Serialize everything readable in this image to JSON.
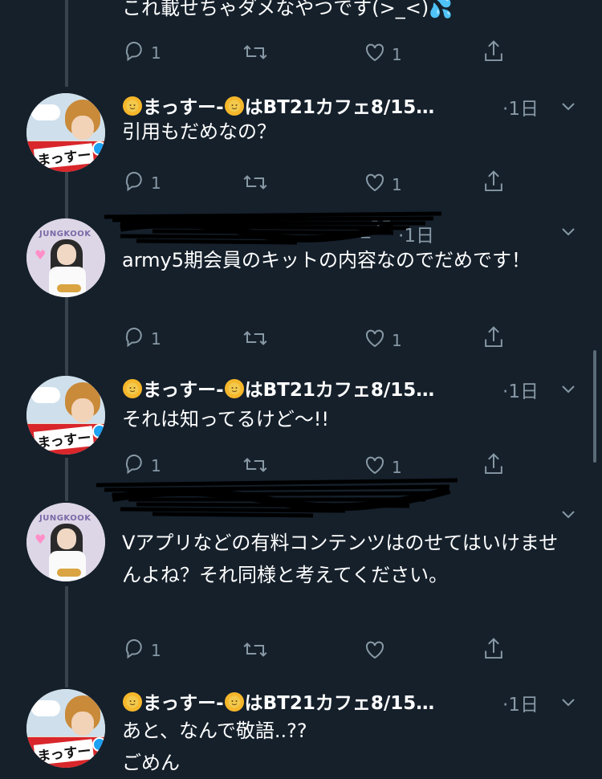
{
  "tweets": [
    {
      "body": "これ載せちゃダメなやつです(>_<)💦",
      "actions": {
        "reply_count": "1",
        "retweet_count": "",
        "like_count": "1"
      }
    },
    {
      "display_name": "まっすー",
      "name_suffix": "はBT21カフェ8/15…",
      "time": "1日",
      "body": "引用もだめなの？",
      "actions": {
        "reply_count": "1",
        "retweet_count": "",
        "like_count": "1"
      }
    },
    {
      "display_name_partial": "_25",
      "time": "1日",
      "body": "army5期会員のキットの内容なのでだめです！",
      "actions": {
        "reply_count": "1",
        "retweet_count": "",
        "like_count": "1"
      }
    },
    {
      "display_name": "まっすー",
      "name_suffix": "はBT21カフェ8/15…",
      "time": "1日",
      "body": "それは知ってるけど〜!!",
      "actions": {
        "reply_count": "1",
        "retweet_count": "",
        "like_count": "1"
      }
    },
    {
      "time": "",
      "body": "Vアプリなどの有料コンテンツはのせてはいけませんよね？それ同様と考えてください。",
      "actions": {
        "reply_count": "1",
        "retweet_count": "",
        "like_count": ""
      }
    },
    {
      "display_name": "まっすー",
      "name_suffix": "はBT21カフェ8/15…",
      "time": "1日",
      "body": "あと、なんで敬語..??\nごめん"
    }
  ],
  "avatars": {
    "v_tag": "まっすー",
    "jk_label": "JUNGKOOK"
  },
  "icons": [
    "reply-icon",
    "retweet-icon",
    "like-icon",
    "share-icon",
    "chevron-down-icon",
    "sun-emoji-icon",
    "droplets-emoji"
  ],
  "colors": {
    "background": "#15202b",
    "secondary_text": "#8899a6",
    "thread_line": "#38444d"
  }
}
